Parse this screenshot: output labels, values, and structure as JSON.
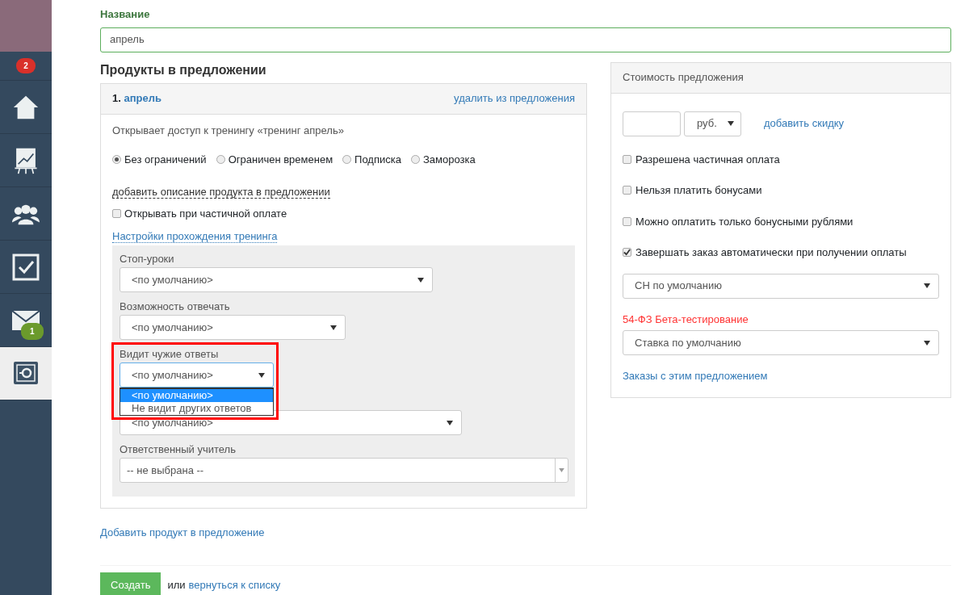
{
  "sidebar": {
    "user_badge": "2",
    "items": [
      {
        "kind": "home",
        "selected": false
      },
      {
        "kind": "chart",
        "selected": false
      },
      {
        "kind": "users",
        "selected": false
      },
      {
        "kind": "check",
        "selected": false
      },
      {
        "kind": "mail",
        "badge": "1",
        "selected": false
      },
      {
        "kind": "safe",
        "selected": true
      }
    ]
  },
  "name_field": {
    "label": "Название",
    "value": "апрель"
  },
  "products": {
    "title": "Продукты в предложении",
    "items": [
      {
        "number": "1.",
        "name": "апрель",
        "remove_link": "удалить из предложения",
        "description": "Открывает доступ к тренингу «тренинг апрель»",
        "access_options": [
          {
            "label": "Без ограничений",
            "selected": true
          },
          {
            "label": "Ограничен временем",
            "selected": false
          },
          {
            "label": "Подписка",
            "selected": false
          },
          {
            "label": "Заморозка",
            "selected": false
          }
        ],
        "add_description_link": "добавить описание продукта в предложении",
        "partial_payment": {
          "label": "Открывать при частичной оплате",
          "checked": false
        },
        "settings_link": "Настройки прохождения тренинга",
        "settings": [
          {
            "kind": "select",
            "label": "Стоп-уроки",
            "value": "<по умолчанию>",
            "expanded": false,
            "highlighted": false
          },
          {
            "kind": "select",
            "label": "Возможность отвечать",
            "value": "<по умолчанию>",
            "expanded": false,
            "highlighted": false
          },
          {
            "kind": "select",
            "label": "Видит чужие ответы",
            "value": "<по умолчанию>",
            "expanded": true,
            "highlighted": true,
            "options": [
              {
                "label": "<по умолчанию>",
                "selected": true
              },
              {
                "label": "Не видит других ответов",
                "selected": false
              }
            ]
          },
          {
            "kind": "select",
            "value": "<по умолчанию>",
            "expanded": false,
            "highlighted": false
          },
          {
            "kind": "combobox",
            "label": "Ответственный учитель",
            "value": "-- не выбрана --",
            "expanded": false,
            "highlighted": false
          }
        ]
      }
    ],
    "add_product_link": "Добавить продукт в предложение"
  },
  "price": {
    "title": "Стоимость предложения",
    "currency": "руб.",
    "discount_link": "добавить скидку",
    "options": [
      {
        "label": "Разрешена частичная оплата",
        "checked": false
      },
      {
        "label": "Нельзя платить бонусами",
        "checked": false
      },
      {
        "label": "Можно оплатить только бонусными рублями",
        "checked": false
      },
      {
        "label": "Завершать заказ автоматически при получении оплаты",
        "checked": true
      }
    ],
    "tax_select": "СН по умолчанию",
    "beta_label": "54-ФЗ Бета-тестирование",
    "rate_select": "Ставка по умолчанию",
    "orders_link": "Заказы с этим предложением"
  },
  "footer": {
    "create_button": "Создать",
    "or_text": "или",
    "back_link": "вернуться к списку"
  }
}
